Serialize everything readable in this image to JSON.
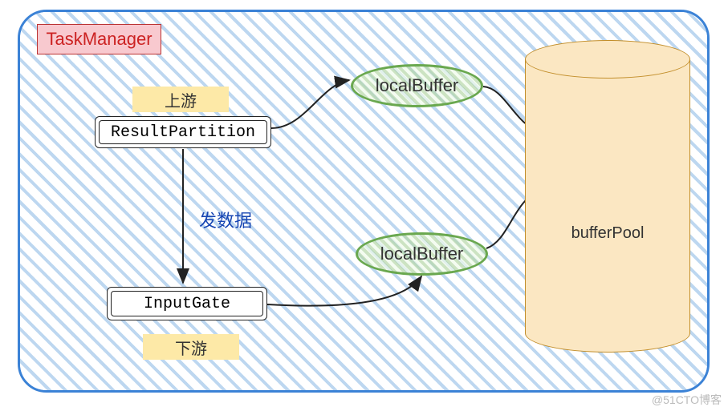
{
  "title": "TaskManager",
  "labels": {
    "upstream": "上游",
    "downstream": "下游",
    "send_data": "发数据"
  },
  "nodes": {
    "result_partition": "ResultPartition",
    "input_gate": "InputGate",
    "local_buffer_top": "localBuffer",
    "local_buffer_bottom": "localBuffer",
    "buffer_pool": "bufferPool"
  },
  "watermark": "@51CTO博客"
}
